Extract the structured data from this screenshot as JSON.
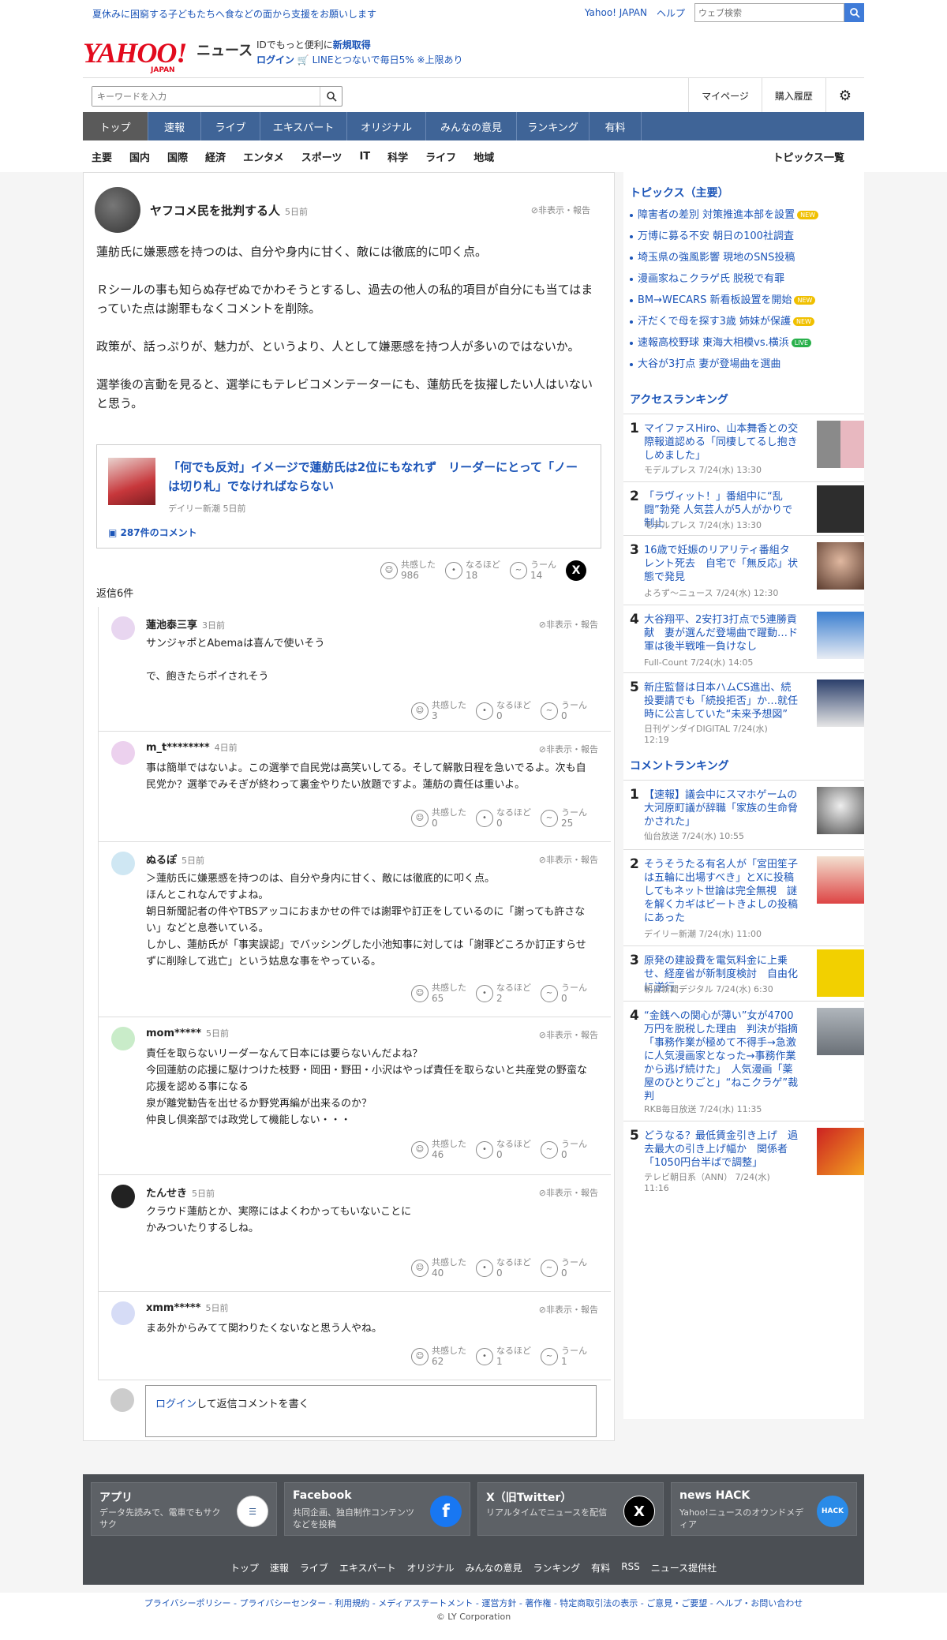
{
  "topbar": {
    "promo": "夏休みに困窮する子どもたちへ食などの面から支援をお願いします",
    "yahoo": "Yahoo! JAPAN",
    "help": "ヘルプ",
    "search_placeholder": "ウェブ検索"
  },
  "header": {
    "logo": "YAHOO!",
    "logo_sub": "JAPAN",
    "news": "ニュース",
    "id_text": "IDでもっと便利に",
    "signup": "新規取得",
    "login": "ログイン",
    "line_text": "LINEとつないで毎日5% ※上限あり"
  },
  "search": {
    "placeholder": "キーワードを入力",
    "mypage": "マイページ",
    "history": "購入履歴"
  },
  "nav": [
    "トップ",
    "速報",
    "ライブ",
    "エキスパート",
    "オリジナル",
    "みんなの意見",
    "ランキング",
    "有料"
  ],
  "subnav": [
    "主要",
    "国内",
    "国際",
    "経済",
    "エンタメ",
    "スポーツ",
    "IT",
    "科学",
    "ライフ",
    "地域"
  ],
  "subnav_all": "トピックス一覧",
  "post": {
    "author": "ヤフコメ民を批判する人",
    "time": "5日前",
    "report": "非表示・報告",
    "paras": [
      "蓮舫氏に嫌悪感を持つのは、自分や身内に甘く、敵には徹底的に叩く点。",
      "Ｒシールの事も知らぬ存ぜぬでかわそうとするし、過去の他人の私的項目が自分にも当てはまっていた点は謝罪もなくコメントを削除。",
      "政策が、話っぷりが、魅力が、というより、人として嫌悪感を持つ人が多いのではないか。",
      "選挙後の言動を見ると、選挙にもテレビコメンテーターにも、蓮舫氏を抜擢したい人はいないと思う。"
    ],
    "article_title": "「何でも反対」イメージで蓮舫氏は2位にもなれず　リーダーにとって「ノーは切り札」でなければならない",
    "article_src": "デイリー新潮 5日前",
    "article_comments": "287件のコメント",
    "r1": "共感した",
    "r2": "なるほど",
    "r3": "うーん",
    "c1": "986",
    "c2": "18",
    "c3": "14"
  },
  "reply_count": "返信6件",
  "replies": [
    {
      "name": "蓮池泰三享",
      "time": "3日前",
      "text": "サンジャポとAbemaは喜んで使いそう\n\nで、飽きたらポイされそう",
      "c1": "3",
      "c2": "0",
      "c3": "0"
    },
    {
      "name": "m_t********",
      "time": "4日前",
      "text": "事は簡単ではないよ。この選挙で自民党は高笑いしてる。そして解散日程を急いでるよ。次も自民党か？選挙でみそぎが終わって裏金やりたい放題ですよ。蓮舫の責任は重いよ。",
      "c1": "0",
      "c2": "0",
      "c3": "25"
    },
    {
      "name": "ぬるぽ",
      "time": "5日前",
      "text": "＞蓮舫氏に嫌悪感を持つのは、自分や身内に甘く、敵には徹底的に叩く点。\nほんとこれなんですよね。\n朝日新聞記者の件やTBSアッコにおまかせの件では謝罪や訂正をしているのに「謝っても許さない」などと息巻いている。\nしかし、蓮舫氏が「事実誤認」でバッシングした小池知事に対しては「謝罪どころか訂正すらせずに削除して逃亡」という姑息な事をやっている。",
      "c1": "65",
      "c2": "2",
      "c3": "0"
    },
    {
      "name": "mom*****",
      "time": "5日前",
      "text": "責任を取らないリーダーなんて日本には要らないんだよね？\n今回蓮舫の応援に駆けつけた枝野・岡田・野田・小沢はやっぱ責任を取らないと共産党の野蛮な応援を認める事になる\n泉が離党勧告を出せるか野党再編が出来るのか？\n仲良し倶楽部では政党して機能しない・・・",
      "c1": "46",
      "c2": "0",
      "c3": "0"
    },
    {
      "name": "たんせき",
      "time": "5日前",
      "text": "クラウド蓮舫とか、実際にはよくわかってもいないことに\nかみついたりするしね。",
      "c1": "40",
      "c2": "0",
      "c3": "0"
    },
    {
      "name": "xmm*****",
      "time": "5日前",
      "text": "まあ外からみてて関わりたくないなと思う人やね。",
      "c1": "62",
      "c2": "1",
      "c3": "1"
    }
  ],
  "login_reply": {
    "login": "ログイン",
    "rest": "して返信コメントを書く"
  },
  "topics": {
    "title": "トピックス（主要）",
    "items": [
      {
        "text": "障害者の差別 対策推進本部を設置",
        "badge": "NEW"
      },
      {
        "text": "万博に募る不安 朝日の100社調査",
        "badge": ""
      },
      {
        "text": "埼玉県の強風影響 現地のSNS投稿",
        "badge": ""
      },
      {
        "text": "漫画家ねこクラゲ氏 脱税で有罪",
        "badge": ""
      },
      {
        "text": "BM→WECARS 新看板設置を開始",
        "badge": "NEW"
      },
      {
        "text": "汗だくで母を探す3歳 姉妹が保護",
        "badge": "NEW"
      },
      {
        "text": "速報高校野球 東海大相模vs.横浜",
        "badge": "LIVE"
      },
      {
        "text": "大谷が3打点 妻が登場曲を選曲",
        "badge": ""
      }
    ]
  },
  "access": {
    "title": "アクセスランキング",
    "items": [
      {
        "n": "1",
        "t": "マイファスHiro、山本舞香との交際報道認める「同棲してるし抱きしめました」",
        "s": "モデルプレス 7/24(水) 13:30"
      },
      {
        "n": "2",
        "t": "「ラヴィット！」番組中に“乱闘”勃発 人気芸人が5人がかりで制止",
        "s": "モデルプレス 7/24(水) 13:30"
      },
      {
        "n": "3",
        "t": "16歳で妊娠のリアリティ番組タレント死去　自宅で「無反応」状態で発見",
        "s": "よろず～ニュース 7/24(水) 12:30"
      },
      {
        "n": "4",
        "t": "大谷翔平、2安打3打点で5連勝貢献　妻が選んだ登場曲で躍動…ド軍は後半戦唯一負けなし",
        "s": "Full-Count 7/24(水) 14:05"
      },
      {
        "n": "5",
        "t": "新庄監督は日本ハムCS進出、続投要請でも「続投拒否」か…就任時に公言していた“未来予想図”",
        "s": "日刊ゲンダイDIGITAL 7/24(水) 12:19"
      }
    ]
  },
  "comment_rank": {
    "title": "コメントランキング",
    "items": [
      {
        "n": "1",
        "t": "【速報】議会中にスマホゲームの大河原町議が辞職「家族の生命脅かされた」",
        "s": "仙台放送 7/24(水) 10:55"
      },
      {
        "n": "2",
        "t": "そうそうたる有名人が「宮田笙子は五輪に出場すべき」とXに投稿してもネット世論は完全無視　謎を解くカギはビートきよしの投稿にあった",
        "s": "デイリー新潮 7/24(水) 11:00"
      },
      {
        "n": "3",
        "t": "原発の建設費を電気料金に上乗せ、経産省が新制度検討　自由化に逆行",
        "s": "朝日新聞デジタル 7/24(水) 6:30"
      },
      {
        "n": "4",
        "t": "“金銭への関心が薄い”女が4700万円を脱税した理由　判決が指摘「事務作業が極めて不得手→急激に人気漫画家となった→事務作業から逃げ続けた」　人気漫画「薬屋のひとりごと」“ねこクラゲ”裁判",
        "s": "RKB毎日放送 7/24(水) 11:35"
      },
      {
        "n": "5",
        "t": "どうなる？最低賃金引き上げ　過去最大の引き上げ幅か　関係者「1050円台半ばで調整」",
        "s": "テレビ朝日系（ANN） 7/24(水) 11:16"
      }
    ]
  },
  "footer": {
    "cards": [
      {
        "t": "アプリ",
        "d": "データ先読みで、電車でもサクサク"
      },
      {
        "t": "Facebook",
        "d": "共同企画、独自制作コンテンツなどを投稿"
      },
      {
        "t": "X（旧Twitter）",
        "d": "リアルタイムでニュースを配信"
      },
      {
        "t": "news HACK",
        "d": "Yahoo!ニュースのオウンドメディア"
      }
    ],
    "links": [
      "トップ",
      "速報",
      "ライブ",
      "エキスパート",
      "オリジナル",
      "みんなの意見",
      "ランキング",
      "有料",
      "RSS",
      "ニュース提供社"
    ],
    "bottom": "プライバシーポリシー - プライバシーセンター - 利用規約 - メディアステートメント - 運営方針 - 著作権 - 特定商取引法の表示 - ご意見・ご要望 - ヘルプ・お問い合わせ",
    "copyright": "© LY Corporation"
  },
  "colors": {
    "accent": "#1c55b8",
    "nav": "#3f6497",
    "logo": "#e20a1d"
  }
}
